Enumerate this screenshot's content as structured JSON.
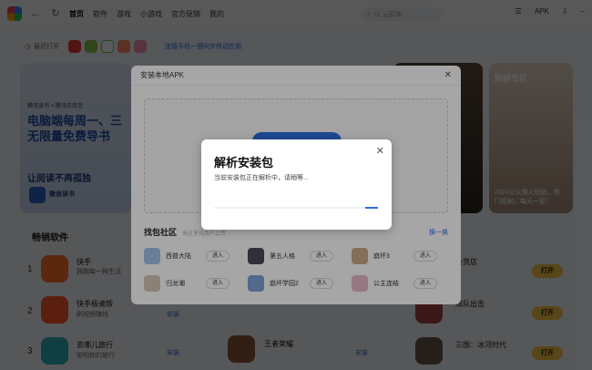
{
  "topbar": {
    "nav": [
      "首页",
      "软件",
      "游戏",
      "小游戏",
      "官方促销",
      "我的"
    ],
    "search_placeholder": "认 云原神",
    "apk_label": "APK"
  },
  "recent": {
    "label": "最近打开",
    "link": "连接手机一键同步移动应用"
  },
  "banners": {
    "left_logos": "腾讯读书 × 腾讯应用宝",
    "left_title_1": "电脑端每周一、三",
    "left_title_2": "无限量免费导书",
    "left_slogan": "让阅读不再孤独",
    "left_app": "微信读书",
    "right_header": "短剧专区",
    "right_caption_1": "2024公认爆火短剧，热",
    "right_caption_2": "门短剧，每天一更！"
  },
  "bestsellers": {
    "title": "畅销软件",
    "rows": [
      {
        "rank": "1",
        "name": "快手",
        "desc": "拥抱每一种生活"
      },
      {
        "rank": "2",
        "name": "快手极速版",
        "desc": "刷视频赚钱"
      },
      {
        "rank": "3",
        "name": "去哪儿旅行",
        "desc": "聪明你的旅行"
      }
    ],
    "mid_rows": [
      "王者荣耀"
    ],
    "right_rows": [
      "杂货店",
      "舰队出击",
      "三国：冰河时代"
    ],
    "open_label": "打开",
    "install_label": "安装"
  },
  "dialog": {
    "title": "安装本地APK",
    "community_title": "找包社区",
    "community_sub": "来这里找用户上传",
    "refresh": "换一换",
    "enter_label": "进入",
    "games": [
      "西普大陆",
      "第五人格",
      "崩坏3",
      "归龙潮",
      "崩坏学园2",
      "公主连结"
    ]
  },
  "modal": {
    "title": "解析安装包",
    "message": "当前安装包正在解析中，请稍等...",
    "progress": 0.08
  },
  "colors": {
    "accent": "#2f6fe0",
    "open_button": "#f6c544"
  }
}
